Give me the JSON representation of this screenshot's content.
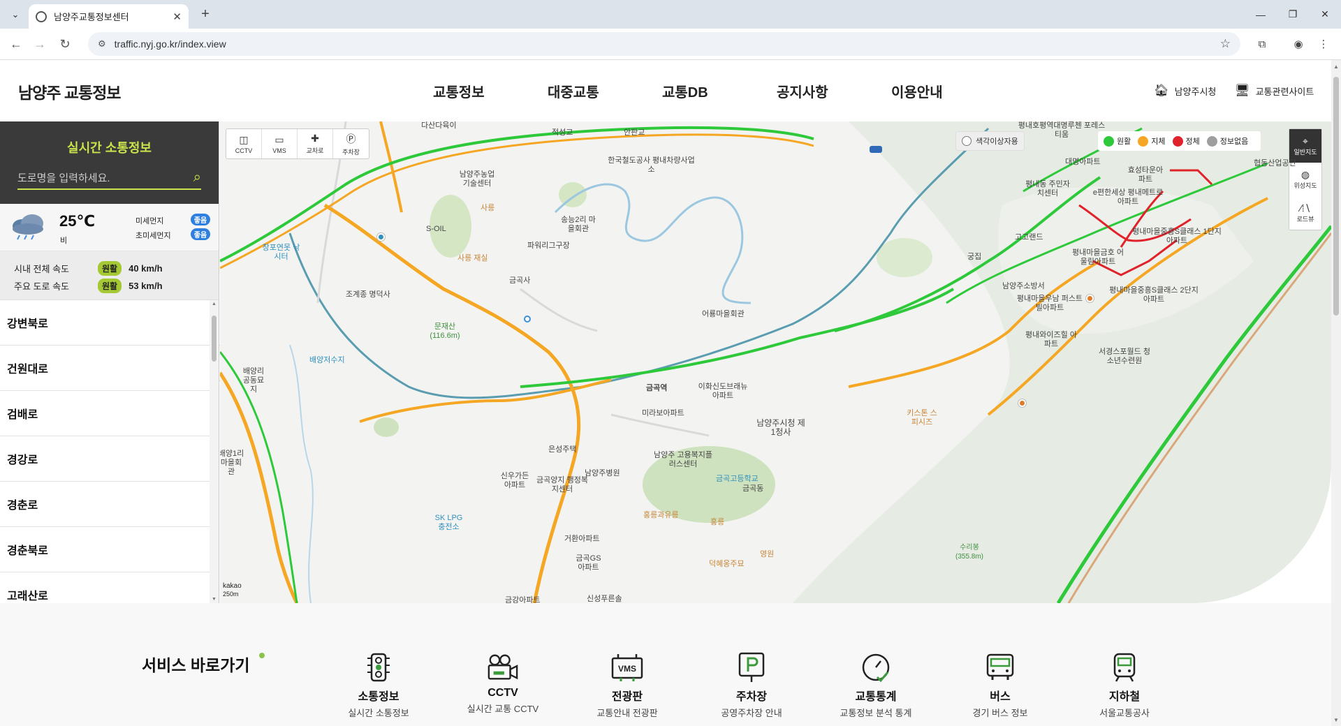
{
  "browser": {
    "tab_title": "남양주교통정보센터",
    "url": "traffic.nyj.go.kr/index.view"
  },
  "header": {
    "logo": "남양주 교통정보",
    "nav": [
      "교통정보",
      "대중교통",
      "교통DB",
      "공지사항",
      "이용안내"
    ],
    "links": {
      "city": "남양주시청",
      "related": "교통관련사이트"
    }
  },
  "sidebar": {
    "title": "실시간 소통정보",
    "search_placeholder": "도로명을 입력하세요.",
    "weather": {
      "temp": "25℃",
      "desc": "비",
      "pm10_label": "미세먼지",
      "pm10_value": "좋음",
      "pm25_label": "초미세먼지",
      "pm25_value": "좋음"
    },
    "speed": [
      {
        "label": "시내 전체 속도",
        "status": "원활",
        "value": "40 km/h"
      },
      {
        "label": "주요 도로 속도",
        "status": "원활",
        "value": "53 km/h"
      }
    ],
    "roads": [
      "강변북로",
      "건원대로",
      "검배로",
      "경강로",
      "경춘로",
      "경춘북로",
      "고래산로"
    ]
  },
  "map": {
    "tools": [
      "CCTV",
      "VMS",
      "교차로",
      "주차장"
    ],
    "colorblind_label": "색각이상자용",
    "legend": [
      {
        "label": "원활",
        "color": "#2ec93a"
      },
      {
        "label": "지체",
        "color": "#f5a623"
      },
      {
        "label": "정체",
        "color": "#e0222a"
      },
      {
        "label": "정보없음",
        "color": "#9e9e9e"
      }
    ],
    "map_types": [
      "일반지도",
      "위성지도",
      "로드뷰"
    ],
    "scale": "250m",
    "provider": "kakao",
    "labels": [
      "다산다육이",
      "적성교",
      "안판교",
      "남양주농업기술센터",
      "한국철도공사 평내차량사업소",
      "송능2리 마을회관",
      "사릉",
      "파워리그구장",
      "S-OIL",
      "창포연못 낚시터",
      "사릉 재실",
      "금곡사",
      "조계종 명덕사",
      "문재산(116.6m)",
      "어룡마을회관",
      "배양리 공동묘지",
      "배양저수지",
      "금곡역",
      "이화신도브래뉴아파트",
      "미라보아파트",
      "남양주시청 제1청사",
      "은성주택",
      "신우가든아파트",
      "금곡양지 행정복지센터",
      "남양주병원",
      "남양주 고용복지플러스센터",
      "금곡고등학교",
      "금곡동",
      "SK LPG 충전소",
      "홍릉과유릉",
      "홍릉",
      "거환아파트",
      "금곡GS아파트",
      "덕혜옹주묘",
      "영원",
      "신성푸른솔",
      "금강아파트",
      "키스톤 스피시즈",
      "서경스포월드 청소년수련원",
      "수리봉 (355.8m)",
      "평내호평역대명루첸 포레스티움",
      "대명아파트",
      "효성타운아파트",
      "평내동 주민자치센터",
      "e편한세상 평내메트로아파트",
      "고고랜드",
      "평내마을금호 어울림아파트",
      "평내마을중흥S클래스 1단지아파트",
      "평내마을중흥S클래스 2단지아파트",
      "남양주소방서",
      "평내마을우남 퍼스트빌아파트",
      "평내와이즈힐 아파트",
      "궁집",
      "협동산업공단",
      "배양1리 마을회관"
    ]
  },
  "services": {
    "title": "서비스 바로가기",
    "items": [
      {
        "name": "소통정보",
        "desc": "실시간 소통정보",
        "icon": "traffic-light-icon"
      },
      {
        "name": "CCTV",
        "desc": "실시간 교통 CCTV",
        "icon": "camera-icon"
      },
      {
        "name": "전광판",
        "desc": "교통안내 전광판",
        "icon": "vms-icon"
      },
      {
        "name": "주차장",
        "desc": "공영주차장 안내",
        "icon": "parking-icon"
      },
      {
        "name": "교통통계",
        "desc": "교통정보 분석 통계",
        "icon": "gauge-icon"
      },
      {
        "name": "버스",
        "desc": "경기 버스 정보",
        "icon": "bus-icon"
      },
      {
        "name": "지하철",
        "desc": "서울교통공사",
        "icon": "subway-icon"
      }
    ]
  }
}
